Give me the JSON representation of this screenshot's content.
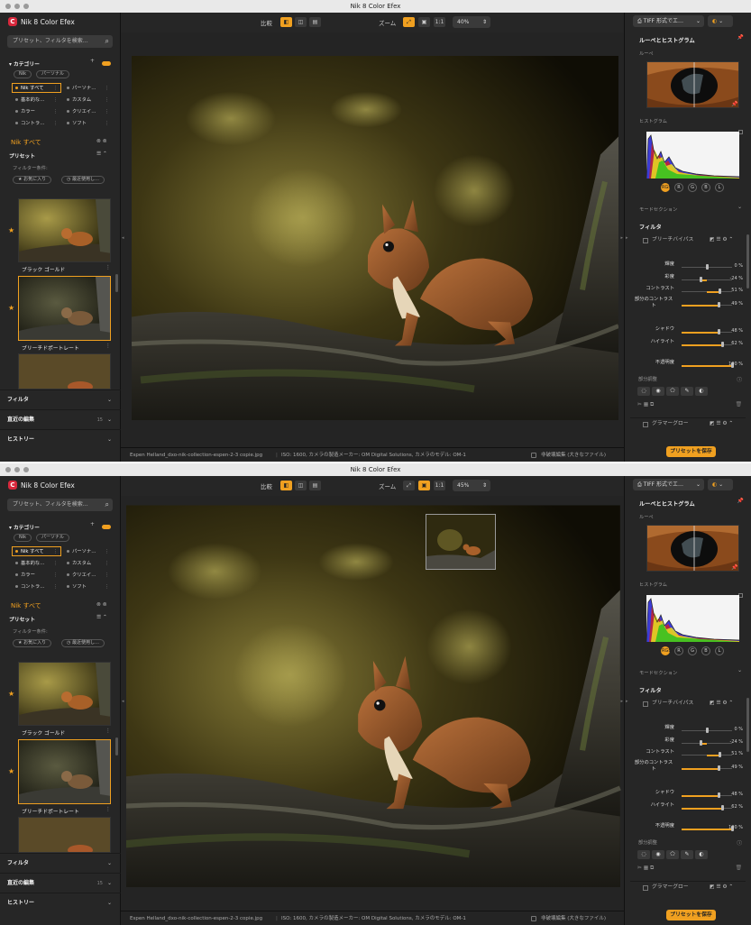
{
  "app": {
    "title": "Nik 8 Color Efex",
    "logo_letter": "C"
  },
  "windows": [
    {
      "titlebar": "Nik 8 Color Efex",
      "left": {
        "search_placeholder": "プリセット、フィルタを検索…",
        "category_label": "カテゴリー",
        "chips": [
          "Nik",
          "パーソナル"
        ],
        "categories": [
          {
            "label": "Nik すべて",
            "selected": true
          },
          {
            "label": "パーソナ…",
            "selected": false
          },
          {
            "label": "基本的な…",
            "selected": false
          },
          {
            "label": "カスタム",
            "selected": false
          },
          {
            "label": "カラー",
            "selected": false
          },
          {
            "label": "クリエイ…",
            "selected": false
          },
          {
            "label": "コントラ…",
            "selected": false
          },
          {
            "label": "ソフト",
            "selected": false
          }
        ],
        "current_collection": "Nik すべて",
        "presets_label": "プリセット",
        "filter_condition": "フィルター条件:",
        "fav_chip": "★ お気に入り",
        "recent_chip": "◷ 最近使用し…",
        "thumb1_caption": "ブラック ゴールド",
        "thumb2_caption": "ブリーチドポートレート",
        "filter_section": "フィルタ",
        "recent_edits": "直近の編集",
        "recent_edits_count": "15",
        "history": "ヒストリー"
      },
      "toolbar": {
        "compare": "比較",
        "zoom": "ズーム",
        "one_to_one": "1:1",
        "zoom_value": "40%"
      },
      "status": {
        "filename": "Espen Helland_dxo-nik-collection-espen-2-3 copie.jpg",
        "exif": "ISO: 1600, カメラの製造メーカー: OM Digital Solutions, カメラのモデル: OM-1",
        "nondestructive": "非破壊編集 (大きなファイル)"
      },
      "right": {
        "export_format": "TIFF 形式でエ…",
        "loupe_hist": "ルーペとヒストグラム",
        "loupe": "ルーペ",
        "histogram": "ヒストグラム",
        "channels": [
          "RGB",
          "R",
          "G",
          "B",
          "L"
        ],
        "mode_section": "モードセクション",
        "filter": "フィルタ",
        "filter_name": "ブリーチバイパス",
        "sliders": [
          {
            "label": "輝度",
            "value_text": "0 %",
            "value": 0
          },
          {
            "label": "彩度",
            "value_text": "-24 %",
            "value": -24
          },
          {
            "label": "コントラスト",
            "value_text": "51 %",
            "value": 51
          },
          {
            "label": "部分のコントラスト",
            "value_text": "49 %",
            "value": 49
          },
          {
            "label": "シャドウ",
            "value_text": "48 %",
            "value": 48
          },
          {
            "label": "ハイライト",
            "value_text": "62 %",
            "value": 62
          },
          {
            "label": "不透明度",
            "value_text": "100 %",
            "value": 100
          }
        ],
        "partial_adjust": "部分調整",
        "glamour_glow": "グラマーグロー",
        "save_preset": "プリセットを保存"
      }
    },
    {
      "titlebar": "Nik 8 Color Efex",
      "toolbar": {
        "compare": "比較",
        "zoom": "ズーム",
        "one_to_one": "1:1",
        "zoom_value": "45%"
      },
      "status": {
        "filename": "Espen Helland_dxo-nik-collection-espen-2-3 copie.jpg",
        "exif": "ISO: 1600, カメラの製造メーカー: OM Digital Solutions, カメラのモデル: OM-1",
        "nondestructive": "非破壊編集 (大きなファイル)"
      }
    }
  ],
  "colors": {
    "accent": "#f0a020",
    "panel": "#262626",
    "canvas": "#242424"
  }
}
